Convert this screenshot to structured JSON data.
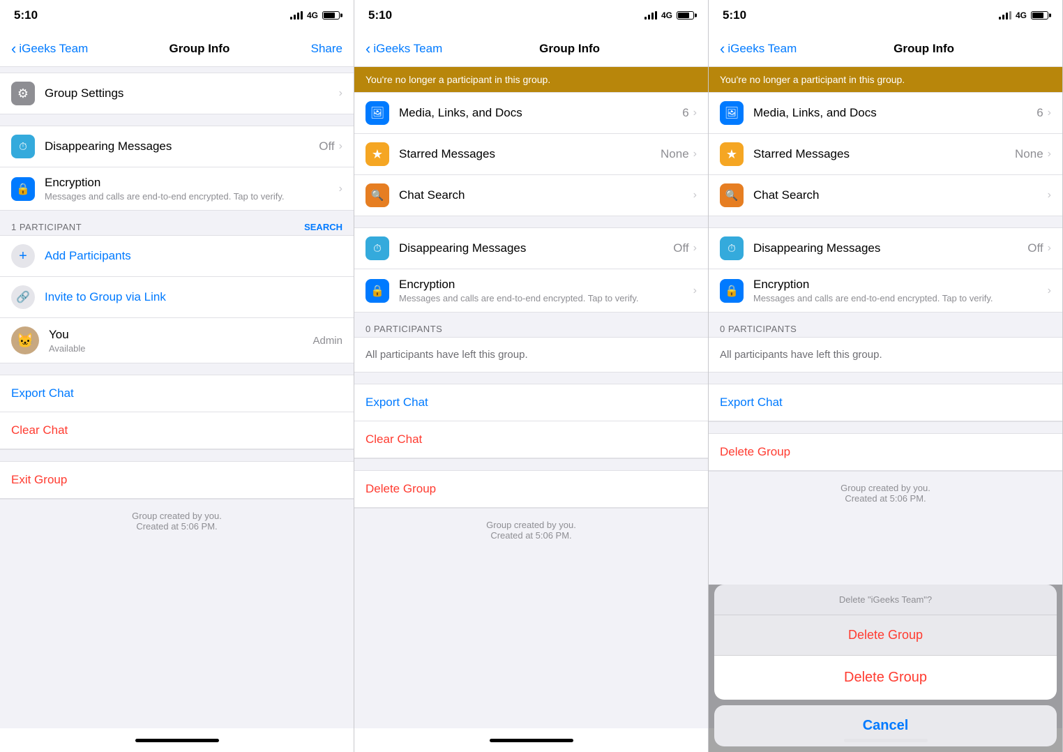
{
  "panels": [
    {
      "id": "panel1",
      "statusBar": {
        "time": "5:10",
        "carrier": "4G"
      },
      "navBar": {
        "backLabel": "iGeeks Team",
        "title": "Group Info",
        "actionLabel": "Share"
      },
      "warningBanner": null,
      "sections": [
        {
          "id": "settings",
          "items": [
            {
              "icon": "gear",
              "iconBg": "gray",
              "title": "Group Settings",
              "value": "",
              "hasChevron": true
            }
          ]
        },
        {
          "id": "features",
          "items": [
            {
              "icon": "timer",
              "iconBg": "teal",
              "title": "Disappearing Messages",
              "value": "Off",
              "hasChevron": true
            },
            {
              "icon": "lock",
              "iconBg": "blue",
              "title": "Encryption",
              "subtitle": "Messages and calls are end-to-end encrypted. Tap to verify.",
              "value": "",
              "hasChevron": true
            }
          ]
        }
      ],
      "participantsHeader": {
        "label": "1 PARTICIPANT",
        "searchLabel": "SEARCH"
      },
      "participantActions": [
        {
          "type": "add",
          "label": "Add Participants"
        },
        {
          "type": "link",
          "label": "Invite to Group via Link"
        }
      ],
      "participants": [
        {
          "name": "You",
          "subtitle": "Available",
          "role": "Admin"
        }
      ],
      "actions": [
        {
          "type": "blue",
          "label": "Export Chat"
        },
        {
          "type": "red",
          "label": "Clear Chat"
        }
      ],
      "bottomAction": {
        "type": "red",
        "label": "Exit Group"
      },
      "footer": "Group created by you.\nCreated at 5:06 PM.",
      "actionSheet": null
    },
    {
      "id": "panel2",
      "statusBar": {
        "time": "5:10",
        "carrier": "4G"
      },
      "navBar": {
        "backLabel": "iGeeks Team",
        "title": "Group Info",
        "actionLabel": ""
      },
      "warningBanner": "You're no longer a participant in this group.",
      "sections": [
        {
          "id": "media",
          "items": [
            {
              "icon": "photo",
              "iconBg": "blue",
              "title": "Media, Links, and Docs",
              "value": "6",
              "hasChevron": true
            },
            {
              "icon": "star",
              "iconBg": "yellow",
              "title": "Starred Messages",
              "value": "None",
              "hasChevron": true
            },
            {
              "icon": "search",
              "iconBg": "orange",
              "title": "Chat Search",
              "value": "",
              "hasChevron": true
            }
          ]
        },
        {
          "id": "features2",
          "items": [
            {
              "icon": "timer",
              "iconBg": "teal",
              "title": "Disappearing Messages",
              "value": "Off",
              "hasChevron": true
            },
            {
              "icon": "lock",
              "iconBg": "blue",
              "title": "Encryption",
              "subtitle": "Messages and calls are end-to-end encrypted. Tap to verify.",
              "value": "",
              "hasChevron": true
            }
          ]
        }
      ],
      "participantsHeader": {
        "label": "0 PARTICIPANTS",
        "searchLabel": ""
      },
      "participantActions": [],
      "participants": [],
      "emptyParticipants": "All participants have left this group.",
      "actions": [
        {
          "type": "blue",
          "label": "Export Chat"
        },
        {
          "type": "red",
          "label": "Clear Chat"
        }
      ],
      "bottomAction": {
        "type": "red",
        "label": "Delete Group"
      },
      "footer": "Group created by you.\nCreated at 5:06 PM.",
      "actionSheet": null
    },
    {
      "id": "panel3",
      "statusBar": {
        "time": "5:10",
        "carrier": "4G"
      },
      "navBar": {
        "backLabel": "iGeeks Team",
        "title": "Group Info",
        "actionLabel": ""
      },
      "warningBanner": "You're no longer a participant in this group.",
      "sections": [
        {
          "id": "media3",
          "items": [
            {
              "icon": "photo",
              "iconBg": "blue",
              "title": "Media, Links, and Docs",
              "value": "6",
              "hasChevron": true
            },
            {
              "icon": "star",
              "iconBg": "yellow",
              "title": "Starred Messages",
              "value": "None",
              "hasChevron": true
            },
            {
              "icon": "search",
              "iconBg": "orange",
              "title": "Chat Search",
              "value": "",
              "hasChevron": true
            }
          ]
        },
        {
          "id": "features3",
          "items": [
            {
              "icon": "timer",
              "iconBg": "teal",
              "title": "Disappearing Messages",
              "value": "Off",
              "hasChevron": true
            },
            {
              "icon": "lock",
              "iconBg": "blue",
              "title": "Encryption",
              "subtitle": "Messages and calls are end-to-end encrypted. Tap to verify.",
              "value": "",
              "hasChevron": true
            }
          ]
        }
      ],
      "participantsHeader": {
        "label": "0 PARTICIPANTS",
        "searchLabel": ""
      },
      "participantActions": [],
      "participants": [],
      "emptyParticipants": "All participants have left this group.",
      "actions": [
        {
          "type": "blue",
          "label": "Export Chat"
        }
      ],
      "bottomAction": {
        "type": "red",
        "label": "Delete Group"
      },
      "footer": "Group created by you.\nCreated at 5:06 PM.",
      "actionSheet": {
        "title": "Delete \"iGeeks Team\"?",
        "buttons": [
          {
            "label": "Delete Group",
            "type": "red"
          },
          {
            "label": "Delete Group",
            "type": "red-main"
          }
        ],
        "cancelLabel": "Cancel"
      }
    }
  ],
  "icons": {
    "gear": "⚙",
    "timer": "⏱",
    "lock": "🔒",
    "photo": "🖼",
    "star": "★",
    "search": "🔍",
    "add": "+",
    "link": "🔗",
    "back": "‹",
    "chevron": "›"
  }
}
